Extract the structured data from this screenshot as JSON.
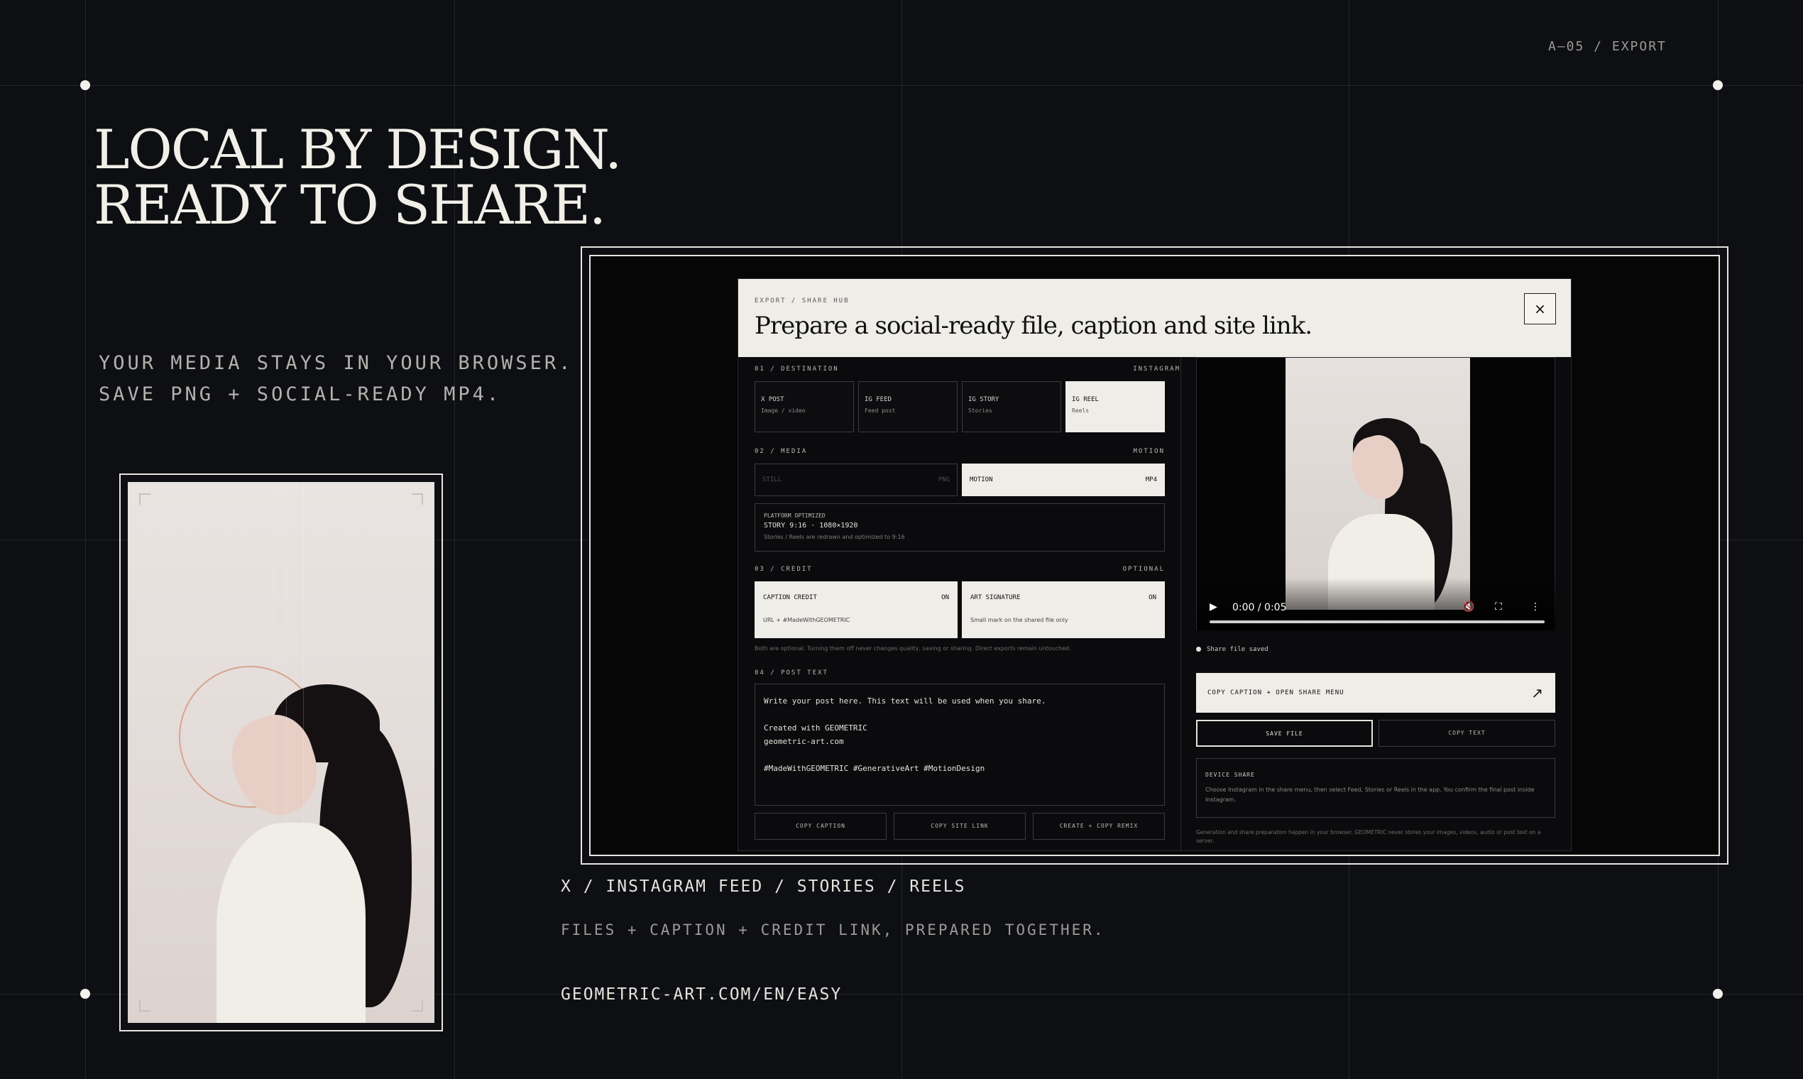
{
  "page": {
    "code": "A–05 / EXPORT",
    "headline": [
      "LOCAL BY DESIGN.",
      "READY TO SHARE."
    ],
    "subtitle": [
      "YOUR MEDIA STAYS IN YOUR BROWSER.",
      "SAVE PNG + SOCIAL-READY MP4."
    ],
    "platforms": "X / INSTAGRAM FEED / STORIES / REELS",
    "files_line": "FILES + CAPTION + CREDIT LINK, PREPARED TOGETHER.",
    "url": "GEOMETRIC-ART.COM/EN/EASY"
  },
  "modal": {
    "kicker": "EXPORT / SHARE HUB",
    "title": "Prepare a social-ready file, caption and site link.",
    "close_label": "×",
    "destination": {
      "heading": "01 / DESTINATION",
      "current": "INSTAGRAM",
      "options": [
        {
          "label": "X POST",
          "sub": "Image / video"
        },
        {
          "label": "IG FEED",
          "sub": "Feed post"
        },
        {
          "label": "IG STORY",
          "sub": "Stories"
        },
        {
          "label": "IG REEL",
          "sub": "Reels"
        }
      ],
      "selected_index": 3
    },
    "media": {
      "heading": "02 / MEDIA",
      "current": "MOTION",
      "still_label": "STILL",
      "still_format": "PNG",
      "motion_label": "MOTION",
      "motion_format": "MP4",
      "optimized_label": "PLATFORM OPTIMIZED",
      "optimized_value": "STORY 9:16 · 1080×1920",
      "optimized_note": "Stories / Reels are redrawn and optimized to 9:16"
    },
    "credit": {
      "heading": "03 / CREDIT",
      "current": "OPTIONAL",
      "caption_credit": {
        "label": "CAPTION CREDIT",
        "state": "ON",
        "sub": "URL + #MadeWithGEOMETRIC"
      },
      "art_signature": {
        "label": "ART SIGNATURE",
        "state": "ON",
        "sub": "Small mark on the shared file only"
      },
      "note": "Both are optional. Turning them off never changes quality, saving or sharing. Direct exports remain untouched."
    },
    "post_text": {
      "heading": "04 / POST TEXT",
      "value": "Write your post here. This text will be used when you share.\n\nCreated with GEOMETRIC\ngeometric-art.com\n\n#MadeWithGEOMETRIC #GenerativeArt #MotionDesign",
      "buttons": [
        "COPY CAPTION",
        "COPY SITE LINK",
        "CREATE + COPY REMIX"
      ]
    },
    "video": {
      "play": "▶",
      "time": "0:00 / 0:05",
      "mute": "🔇",
      "fullscreen": "⛶",
      "more": "⋮",
      "progress": 0
    },
    "saved_status": "Share file saved",
    "share_button": "COPY CAPTION + OPEN SHARE MENU",
    "share_arrow": "↗",
    "save_file": "SAVE FILE",
    "copy_text": "COPY TEXT",
    "device_share": {
      "heading": "DEVICE SHARE",
      "text": "Choose Instagram in the share menu, then select Feed, Stories or Reels in the app. You confirm the final post inside Instagram."
    },
    "privacy_note": "Generation and share preparation happen in your browser. GEOMETRIC never stores your images, videos, audio or post text on a server."
  },
  "colors": {
    "background": "#0e0f13",
    "panel_light": "#efede8",
    "accent_ring": "#d8a491"
  }
}
